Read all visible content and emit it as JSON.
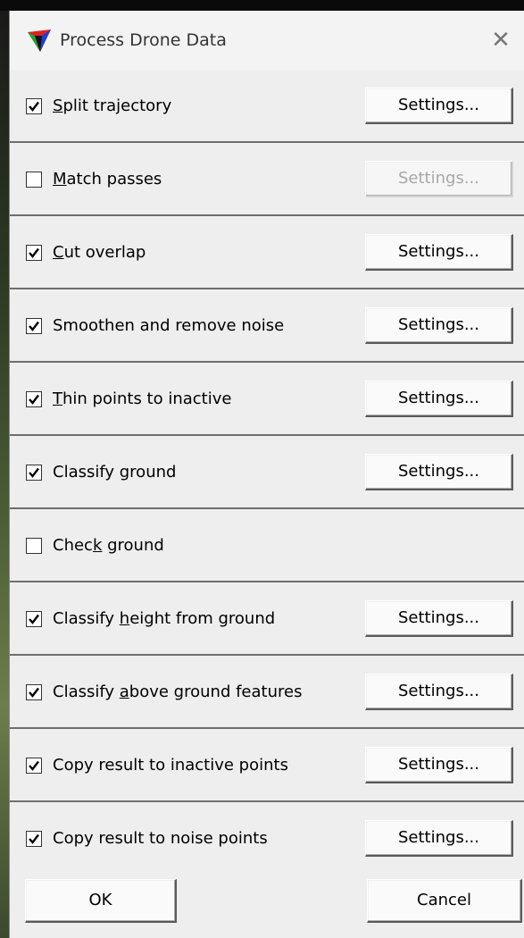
{
  "window": {
    "title": "Process Drone Data",
    "close_glyph": "✕",
    "icon": "triangle-app-icon"
  },
  "rows": [
    {
      "label_before": "",
      "accel": "S",
      "label_after": "plit trajectory",
      "checked": true,
      "button": "Settings...",
      "enabled": true
    },
    {
      "label_before": "",
      "accel": "M",
      "label_after": "atch passes",
      "checked": false,
      "button": "Settings...",
      "enabled": false
    },
    {
      "label_before": "",
      "accel": "C",
      "label_after": "ut overlap",
      "checked": true,
      "button": "Settings...",
      "enabled": true
    },
    {
      "label_before": "Smoothen and remove noise",
      "accel": "",
      "label_after": "",
      "checked": true,
      "button": "Settings...",
      "enabled": true
    },
    {
      "label_before": "",
      "accel": "T",
      "label_after": "hin points to inactive",
      "checked": true,
      "button": "Settings...",
      "enabled": true
    },
    {
      "label_before": "Classify ground",
      "accel": "",
      "label_after": "",
      "checked": true,
      "button": "Settings...",
      "enabled": true
    },
    {
      "label_before": "Chec",
      "accel": "k",
      "label_after": " ground",
      "checked": false,
      "button": "",
      "enabled": true
    },
    {
      "label_before": "Classify ",
      "accel": "h",
      "label_after": "eight from ground",
      "checked": true,
      "button": "Settings...",
      "enabled": true
    },
    {
      "label_before": "Classify ",
      "accel": "a",
      "label_after": "bove ground features",
      "checked": true,
      "button": "Settings...",
      "enabled": true
    },
    {
      "label_before": "Copy result to inactive points",
      "accel": "",
      "label_after": "",
      "checked": true,
      "button": "Settings...",
      "enabled": true
    },
    {
      "label_before": "Copy result to noise points",
      "accel": "",
      "label_after": "",
      "checked": true,
      "button": "Settings...",
      "enabled": true
    }
  ],
  "footer": {
    "ok": "OK",
    "cancel": "Cancel"
  }
}
